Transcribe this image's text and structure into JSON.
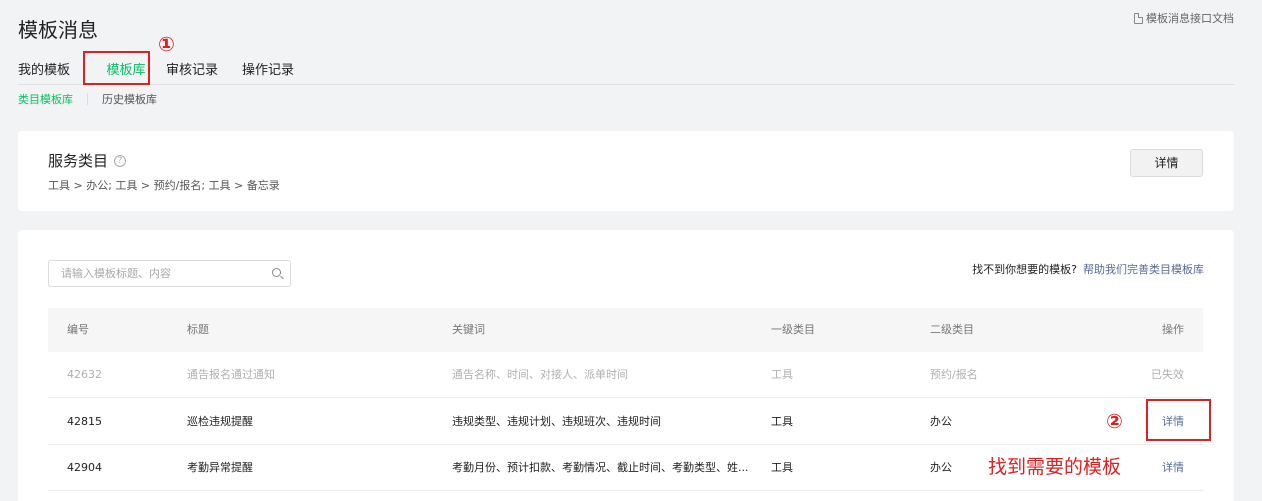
{
  "page": {
    "title": "模板消息",
    "doc_link": "模板消息接口文档"
  },
  "tabs": [
    {
      "label": "我的模板"
    },
    {
      "label": "模板库"
    },
    {
      "label": "审核记录"
    },
    {
      "label": "操作记录"
    }
  ],
  "subtabs": [
    {
      "label": "类目模板库"
    },
    {
      "label": "历史模板库"
    }
  ],
  "service": {
    "title": "服务类目",
    "help_icon": "?",
    "path": "工具 > 办公; 工具 > 预约/报名; 工具 > 备忘录",
    "detail_button": "详情"
  },
  "search": {
    "placeholder": "请输入模板标题、内容",
    "value": ""
  },
  "feedback": {
    "text": "找不到你想要的模板?",
    "link": "帮助我们完善类目模板库"
  },
  "table": {
    "headers": {
      "id": "编号",
      "title": "标题",
      "keywords": "关键词",
      "level1": "一级类目",
      "level2": "二级类目",
      "action": "操作"
    },
    "rows": [
      {
        "id": "42632",
        "title": "通告报名通过通知",
        "keywords": "通告名称、时间、对接人、派单时间",
        "level1": "工具",
        "level2": "预约/报名",
        "action": "已失效"
      },
      {
        "id": "42815",
        "title": "巡检违规提醒",
        "keywords": "违规类型、违规计划、违规班次、违规时间",
        "level1": "工具",
        "level2": "办公",
        "action": "详情"
      },
      {
        "id": "42904",
        "title": "考勤异常提醒",
        "keywords": "考勤月份、预计扣款、考勤情况、截止时间、考勤类型、姓...",
        "level1": "工具",
        "level2": "办公",
        "action": "详情"
      }
    ]
  },
  "annotations": {
    "step1": "①",
    "step2": "②",
    "hint": "找到需要的模板"
  },
  "colors": {
    "accent_green": "#07c160",
    "link_blue": "#576b95",
    "annotation_red": "#e02020"
  }
}
